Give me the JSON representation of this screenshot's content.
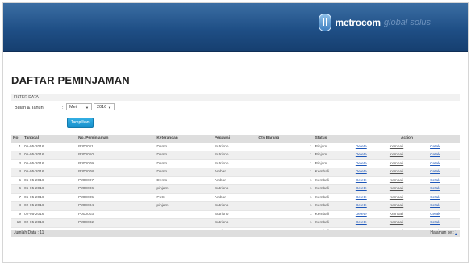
{
  "header": {
    "brand": "metrocom",
    "tagline": "global solus"
  },
  "page": {
    "title": "DAFTAR PEMINJAMAN"
  },
  "filter": {
    "bar_title": "FILTER DATA",
    "label": "Bulan & Tahun",
    "colon": ":",
    "month_value": "Mei",
    "year_value": "2016",
    "show_button": "Tampilkan"
  },
  "table": {
    "headers": [
      "No",
      "Tanggal",
      "No. Peminjaman",
      "Keterangan",
      "Pegawai",
      "Qty Barang",
      "Status",
      "Action"
    ],
    "rows": [
      {
        "no": "1",
        "date": "05-05-2016",
        "code": "PJ00011",
        "note": "Demo",
        "staff": "Sutrisno",
        "qty": "1",
        "status": "Pinjam",
        "a1": "Delete",
        "a2": "Kembali",
        "a3": "Cetak"
      },
      {
        "no": "2",
        "date": "05-05-2016",
        "code": "PJ00010",
        "note": "Demo",
        "staff": "Sutrisno",
        "qty": "1",
        "status": "Pinjam",
        "a1": "Delete",
        "a2": "Kembali",
        "a3": "Cetak"
      },
      {
        "no": "3",
        "date": "05-05-2016",
        "code": "PJ00009",
        "note": "Demo",
        "staff": "Sutrisno",
        "qty": "1",
        "status": "Pinjam",
        "a1": "Delete",
        "a2": "Kembali",
        "a3": "Cetak"
      },
      {
        "no": "4",
        "date": "05-05-2016",
        "code": "PJ00008",
        "note": "Demo",
        "staff": "Ambar",
        "qty": "1",
        "status": "Kembali",
        "a1": "Delete",
        "a2": "Kembali",
        "a3": "Cetak"
      },
      {
        "no": "5",
        "date": "05-05-2016",
        "code": "PJ00007",
        "note": "Demo",
        "staff": "Ambar",
        "qty": "1",
        "status": "Kembali",
        "a1": "Delete",
        "a2": "Kembali",
        "a3": "Cetak"
      },
      {
        "no": "6",
        "date": "05-05-2016",
        "code": "PJ00006",
        "note": "pinjam",
        "staff": "Sutrisno",
        "qty": "1",
        "status": "Kembali",
        "a1": "Delete",
        "a2": "Kembali",
        "a3": "Cetak"
      },
      {
        "no": "7",
        "date": "05-05-2016",
        "code": "PJ00005",
        "note": "PoC",
        "staff": "Ambar",
        "qty": "1",
        "status": "Kembali",
        "a1": "Delete",
        "a2": "Kembali",
        "a3": "Cetak"
      },
      {
        "no": "8",
        "date": "02-05-2016",
        "code": "PJ00004",
        "note": "pinjam",
        "staff": "Sutrisno",
        "qty": "1",
        "status": "Kembali",
        "a1": "Delete",
        "a2": "Kembali",
        "a3": "Cetak"
      },
      {
        "no": "9",
        "date": "02-05-2016",
        "code": "PJ00003",
        "note": "",
        "staff": "Sutrisno",
        "qty": "1",
        "status": "Kembali",
        "a1": "Delete",
        "a2": "Kembali",
        "a3": "Cetak"
      },
      {
        "no": "10",
        "date": "02-05-2016",
        "code": "PJ00002",
        "note": "",
        "staff": "Sutrisno",
        "qty": "1",
        "status": "Kembali",
        "a1": "Delete",
        "a2": "Kembali",
        "a3": "Cetak"
      },
      {
        "no": "11",
        "date": "02-05-2016",
        "code": "PJ00001",
        "note": "",
        "staff": "Sutrisno",
        "qty": "1",
        "status": "Kembali",
        "a1": "Delete",
        "a2": "Kembali",
        "a3": "Cetak"
      }
    ]
  },
  "footer": {
    "total": "Jumlah Data : 11",
    "page_label": "Halaman ke :",
    "page_link": "1"
  }
}
